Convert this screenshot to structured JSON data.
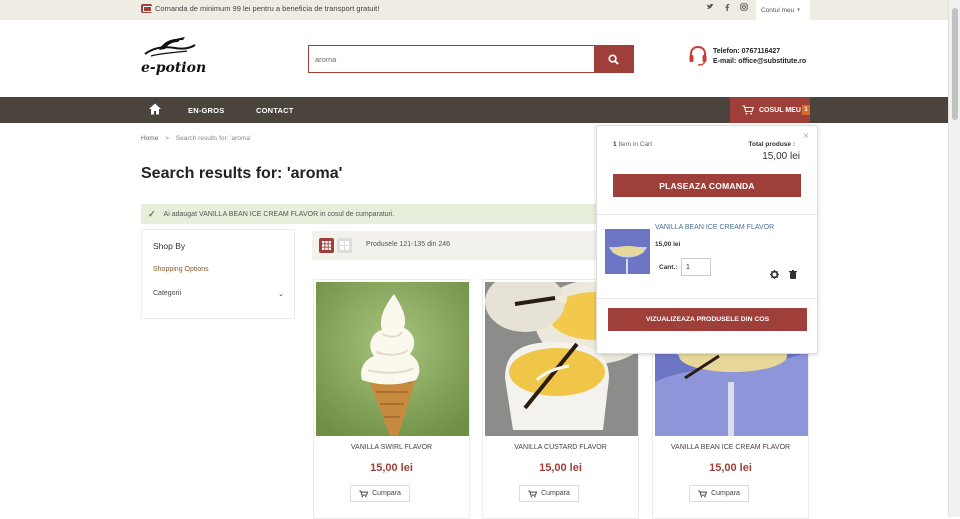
{
  "topbar": {
    "promo_text": "Comanda de minimum 99 lei pentru a beneficia de transport gratuit!",
    "social": [
      "twitter-icon",
      "facebook-icon",
      "instagram-icon"
    ],
    "account_label": "Contul meu"
  },
  "header": {
    "logo_text": "e-potion",
    "search_value": "aroma",
    "phone_label": "Telefon:",
    "phone": "0767116427",
    "email_label": "E-mail:",
    "email": "office@substitute.ro"
  },
  "nav": {
    "items": [
      "EN-GROS",
      "CONTACT"
    ],
    "cart_label": "COSUL MEU",
    "cart_count": "1"
  },
  "breadcrumb": {
    "home": "Home",
    "separator": ">",
    "current": "Search results for: 'aroma'"
  },
  "page_title": "Search results for: 'aroma'",
  "success_message": "Ai adaugat VANILLA BEAN ICE CREAM FLAVOR in cosul de cumparaturi.",
  "sidebar": {
    "title": "Shop By",
    "options_label": "Shopping Options",
    "category_label": "Categorii"
  },
  "toolbar": {
    "count_text": "Produsele 121-135 din 246"
  },
  "products": [
    {
      "name": "VANILLA SWIRL FLAVOR",
      "price": "15,00 lei",
      "button": "Cumpara"
    },
    {
      "name": "VANILLA CUSTARD FLAVOR",
      "price": "15,00 lei",
      "button": "Cumpara"
    },
    {
      "name": "VANILLA BEAN ICE CREAM FLAVOR",
      "price": "15,00 lei",
      "button": "Cumpara"
    }
  ],
  "minicart": {
    "item_count": "1",
    "item_label": "Item in Cart",
    "total_label": "Total produse :",
    "total_value": "15,00 lei",
    "checkout_label": "PLASEAZA COMANDA",
    "product_name": "VANILLA BEAN ICE CREAM FLAVOR",
    "product_price": "15,00 lei",
    "qty_label": "Cant.:",
    "qty_value": "1",
    "view_cart_label": "VIZUALIZEAZA PRODUSELE DIN COS"
  },
  "colors": {
    "brand": "#9e3f3a",
    "nav_bg": "#4a443d",
    "topbar_bg": "#efece4",
    "success_bg": "#e8eedc"
  }
}
